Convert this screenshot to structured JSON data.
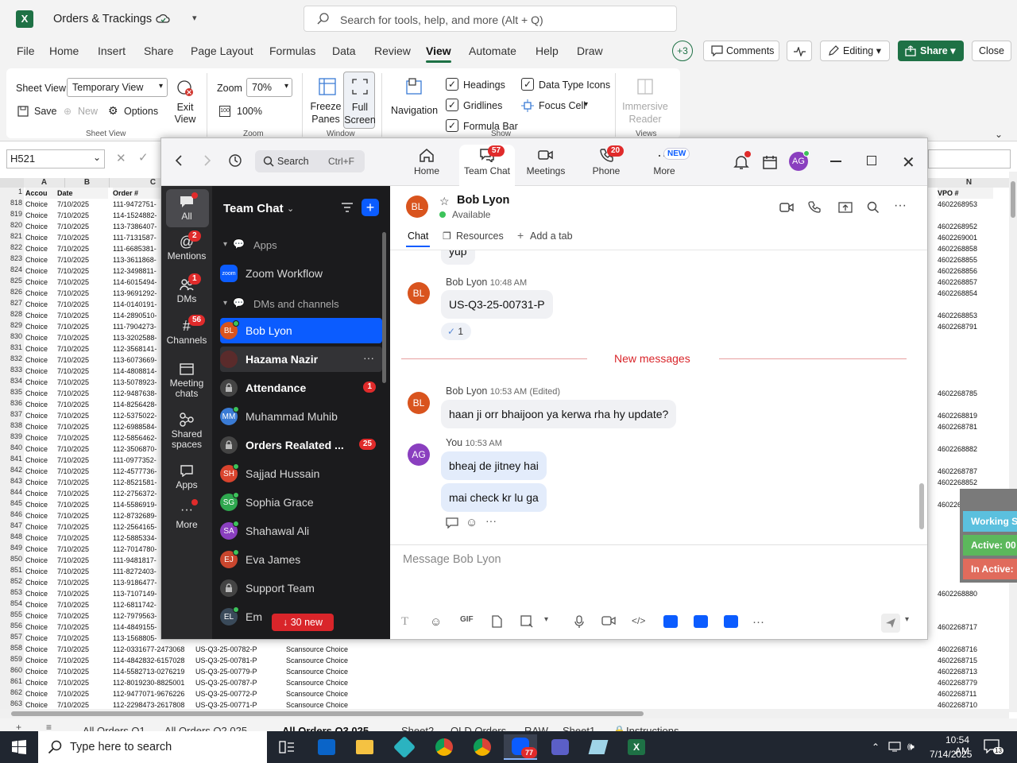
{
  "excel": {
    "title": "Orders & Trackings",
    "search_placeholder": "Search for tools, help, and more (Alt + Q)",
    "menu": [
      "File",
      "Home",
      "Insert",
      "Share",
      "Page Layout",
      "Formulas",
      "Data",
      "Review",
      "View",
      "Automate",
      "Help",
      "Draw"
    ],
    "active_menu": "View",
    "plus_badge": "+3",
    "comments": "Comments",
    "editing": "Editing",
    "share": "Share",
    "close": "Close",
    "ribbon": {
      "sheet_view_label": "Sheet View",
      "sheet_view_value": "Temporary View",
      "save": "Save",
      "new": "New",
      "options": "Options",
      "exit_view": "Exit View",
      "group_sheet_view": "Sheet View",
      "zoom_label": "Zoom",
      "zoom_value": "70%",
      "zoom_100": "100%",
      "group_zoom": "Zoom",
      "freeze_panes": "Freeze Panes",
      "full_screen": "Full Screen",
      "group_window": "Window",
      "navigation": "Navigation",
      "headings": "Headings",
      "gridlines": "Gridlines",
      "formula_bar": "Formula Bar",
      "data_type_icons": "Data Type Icons",
      "focus_cell": "Focus Cell",
      "group_show": "Show",
      "immersive_reader": "Immersive Reader",
      "group_views": "Views"
    },
    "name_box": "H521",
    "columns": [
      "A",
      "B",
      "C",
      "N"
    ],
    "col_headers": {
      "a": "Accou",
      "b": "Date",
      "c": "Order #",
      "n": "VPO #"
    },
    "rows": [
      {
        "n": "818",
        "a": "Choice",
        "b": "7/10/2025",
        "c": "111-9472751-",
        "v": "4602268953"
      },
      {
        "n": "819",
        "a": "Choice",
        "b": "7/10/2025",
        "c": "114-1524882-",
        "v": ""
      },
      {
        "n": "820",
        "a": "Choice",
        "b": "7/10/2025",
        "c": "113-7386407-",
        "v": "4602268952"
      },
      {
        "n": "821",
        "a": "Choice",
        "b": "7/10/2025",
        "c": "111-7131587-",
        "v": "4602269001"
      },
      {
        "n": "822",
        "a": "Choice",
        "b": "7/10/2025",
        "c": "111-6685381-",
        "v": "4602268858"
      },
      {
        "n": "823",
        "a": "Choice",
        "b": "7/10/2025",
        "c": "113-3611868-",
        "v": "4602268855"
      },
      {
        "n": "824",
        "a": "Choice",
        "b": "7/10/2025",
        "c": "112-3498811-",
        "v": "4602268856"
      },
      {
        "n": "825",
        "a": "Choice",
        "b": "7/10/2025",
        "c": "114-6015494-",
        "v": "4602268857"
      },
      {
        "n": "826",
        "a": "Choice",
        "b": "7/10/2025",
        "c": "113-9691292-",
        "v": "4602268854"
      },
      {
        "n": "827",
        "a": "Choice",
        "b": "7/10/2025",
        "c": "114-0140191-",
        "v": ""
      },
      {
        "n": "828",
        "a": "Choice",
        "b": "7/10/2025",
        "c": "114-2890510-",
        "v": "4602268853"
      },
      {
        "n": "829",
        "a": "Choice",
        "b": "7/10/2025",
        "c": "111-7904273-",
        "v": "4602268791"
      },
      {
        "n": "830",
        "a": "Choice",
        "b": "7/10/2025",
        "c": "113-3202588-",
        "v": ""
      },
      {
        "n": "831",
        "a": "Choice",
        "b": "7/10/2025",
        "c": "112-3568141-",
        "v": ""
      },
      {
        "n": "832",
        "a": "Choice",
        "b": "7/10/2025",
        "c": "113-6073669-",
        "v": ""
      },
      {
        "n": "833",
        "a": "Choice",
        "b": "7/10/2025",
        "c": "114-4808814-",
        "v": ""
      },
      {
        "n": "834",
        "a": "Choice",
        "b": "7/10/2025",
        "c": "113-5078923-",
        "v": ""
      },
      {
        "n": "835",
        "a": "Choice",
        "b": "7/10/2025",
        "c": "112-9487638-",
        "v": "4602268785"
      },
      {
        "n": "836",
        "a": "Choice",
        "b": "7/10/2025",
        "c": "114-8256428-",
        "v": ""
      },
      {
        "n": "837",
        "a": "Choice",
        "b": "7/10/2025",
        "c": "112-5375022-",
        "v": "4602268819"
      },
      {
        "n": "838",
        "a": "Choice",
        "b": "7/10/2025",
        "c": "112-6988584-",
        "v": "4602268781"
      },
      {
        "n": "839",
        "a": "Choice",
        "b": "7/10/2025",
        "c": "112-5856462-",
        "v": ""
      },
      {
        "n": "840",
        "a": "Choice",
        "b": "7/10/2025",
        "c": "112-3506870-",
        "v": "4602268882"
      },
      {
        "n": "841",
        "a": "Choice",
        "b": "7/10/2025",
        "c": "111-0977352-",
        "v": ""
      },
      {
        "n": "842",
        "a": "Choice",
        "b": "7/10/2025",
        "c": "112-4577736-",
        "v": "4602268787"
      },
      {
        "n": "843",
        "a": "Choice",
        "b": "7/10/2025",
        "c": "112-8521581-",
        "v": "4602268852"
      },
      {
        "n": "844",
        "a": "Choice",
        "b": "7/10/2025",
        "c": "112-2756372-",
        "v": ""
      },
      {
        "n": "845",
        "a": "Choice",
        "b": "7/10/2025",
        "c": "114-5586919-",
        "v": "4602268786"
      },
      {
        "n": "846",
        "a": "Choice",
        "b": "7/10/2025",
        "c": "112-8732689-",
        "v": ""
      },
      {
        "n": "847",
        "a": "Choice",
        "b": "7/10/2025",
        "c": "112-2564165-",
        "v": ""
      },
      {
        "n": "848",
        "a": "Choice",
        "b": "7/10/2025",
        "c": "112-5885334-",
        "v": ""
      },
      {
        "n": "849",
        "a": "Choice",
        "b": "7/10/2025",
        "c": "112-7014780-",
        "v": ""
      },
      {
        "n": "850",
        "a": "Choice",
        "b": "7/10/2025",
        "c": "111-9481817-",
        "v": ""
      },
      {
        "n": "851",
        "a": "Choice",
        "b": "7/10/2025",
        "c": "111-8272403-",
        "v": ""
      },
      {
        "n": "852",
        "a": "Choice",
        "b": "7/10/2025",
        "c": "113-9186477-",
        "v": ""
      },
      {
        "n": "853",
        "a": "Choice",
        "b": "7/10/2025",
        "c": "113-7107149-",
        "v": "4602268880"
      },
      {
        "n": "854",
        "a": "Choice",
        "b": "7/10/2025",
        "c": "112-6811742-",
        "v": ""
      },
      {
        "n": "855",
        "a": "Choice",
        "b": "7/10/2025",
        "c": "112-7979563-",
        "v": ""
      },
      {
        "n": "856",
        "a": "Choice",
        "b": "7/10/2025",
        "c": "114-4849155-",
        "v": "4602268717"
      },
      {
        "n": "857",
        "a": "Choice",
        "b": "7/10/2025",
        "c": "113-1568805-",
        "v": ""
      }
    ],
    "bottom_rows": [
      {
        "n": "858",
        "a": "Choice",
        "b": "7/10/2025",
        "c": "112-0331677-2473068",
        "d": "US-Q3-25-00782-P",
        "e": "Scansource Choice",
        "v": "4602268716"
      },
      {
        "n": "859",
        "a": "Choice",
        "b": "7/10/2025",
        "c": "114-4842832-6157028",
        "d": "US-Q3-25-00781-P",
        "e": "Scansource Choice",
        "v": "4602268715"
      },
      {
        "n": "860",
        "a": "Choice",
        "b": "7/10/2025",
        "c": "114-5582713-0276219",
        "d": "US-Q3-25-00779-P",
        "e": "Scansource Choice",
        "v": "4602268713"
      },
      {
        "n": "861",
        "a": "Choice",
        "b": "7/10/2025",
        "c": "112-8019230-8825001",
        "d": "US-Q3-25-00787-P",
        "e": "Scansource Choice",
        "v": "4602268779"
      },
      {
        "n": "862",
        "a": "Choice",
        "b": "7/10/2025",
        "c": "112-9477071-9676226",
        "d": "US-Q3-25-00772-P",
        "e": "Scansource Choice",
        "v": "4602268711"
      },
      {
        "n": "863",
        "a": "Choice",
        "b": "7/10/2025",
        "c": "112-2298473-2617808",
        "d": "US-Q3-25-00771-P",
        "e": "Scansource Choice",
        "v": "4602268710"
      }
    ],
    "status_overlay": {
      "working": "Working S",
      "active": "Active: 00",
      "inactive": "In Active:"
    }
  },
  "zoom": {
    "search_label": "Search",
    "search_shortcut": "Ctrl+F",
    "tabs": [
      {
        "label": "Home",
        "badge": ""
      },
      {
        "label": "Team Chat",
        "badge": "57"
      },
      {
        "label": "Meetings",
        "badge": ""
      },
      {
        "label": "Phone",
        "badge": "20"
      },
      {
        "label": "More",
        "badge": "NEW"
      }
    ],
    "user_initials": "AG",
    "rail": [
      {
        "label": "All",
        "badge": ""
      },
      {
        "label": "Mentions",
        "badge": "2"
      },
      {
        "label": "DMs",
        "badge": "1"
      },
      {
        "label": "Channels",
        "badge": "56"
      },
      {
        "label": "Meeting chats",
        "badge": ""
      },
      {
        "label": "Shared spaces",
        "badge": ""
      },
      {
        "label": "Apps",
        "badge": ""
      },
      {
        "label": "More",
        "badge": ""
      }
    ],
    "list_title": "Team Chat",
    "section_apps": "Apps",
    "zoom_workflow": "Zoom Workflow",
    "zoom_logo_text": "zoom",
    "section_dms": "DMs and channels",
    "contacts": [
      {
        "initials": "BL",
        "name": "Bob Lyon",
        "color": "#d9541e",
        "bold": false,
        "badge": ""
      },
      {
        "initials": "",
        "name": "Hazama Nazir",
        "color": "#5a2b2b",
        "bold": true,
        "badge": ""
      },
      {
        "initials": "",
        "name": "Attendance",
        "color": "#444",
        "bold": true,
        "badge": "1"
      },
      {
        "initials": "MM",
        "name": "Muhammad Muhib",
        "color": "#3a7bd5",
        "bold": false,
        "badge": ""
      },
      {
        "initials": "",
        "name": "Orders Realated ...",
        "color": "#444",
        "bold": true,
        "badge": "25"
      },
      {
        "initials": "SH",
        "name": "Sajjad Hussain",
        "color": "#d9442e",
        "bold": false,
        "badge": ""
      },
      {
        "initials": "SG",
        "name": "Sophia Grace",
        "color": "#2fa84f",
        "bold": false,
        "badge": ""
      },
      {
        "initials": "SA",
        "name": "Shahawal Ali",
        "color": "#8a3fbf",
        "bold": false,
        "badge": ""
      },
      {
        "initials": "EJ",
        "name": "Eva James",
        "color": "#c9462e",
        "bold": false,
        "badge": ""
      },
      {
        "initials": "",
        "name": "Support Team",
        "color": "#444",
        "bold": false,
        "badge": ""
      },
      {
        "initials": "EL",
        "name": "Em",
        "color": "#3a4a5a",
        "bold": false,
        "badge": ""
      }
    ],
    "new_pill": "↓ 30 new",
    "chat": {
      "name": "Bob Lyon",
      "initials": "BL",
      "status": "Available",
      "tab_chat": "Chat",
      "tab_resources": "Resources",
      "tab_add": "Add a tab",
      "prev_bubble": "yup",
      "m1_sender": "Bob Lyon",
      "m1_time": "10:48 AM",
      "m1_text": "US-Q3-25-00731-P",
      "m1_reaction": "1",
      "new_messages": "New messages",
      "m2_sender": "Bob Lyon",
      "m2_time": "10:53 AM",
      "m2_edited": "(Edited)",
      "m2_text": "haan ji orr bhaijoon ya kerwa rha hy update?",
      "m3_sender": "You",
      "m3_time": "10:53 AM",
      "m3_initials": "AG",
      "m3_text1": "bheaj de jitney hai",
      "m3_text2": "mai check kr lu ga",
      "compose_placeholder": "Message Bob Lyon",
      "gif": "GIF"
    }
  },
  "sheet_tabs": [
    "All Orders Q1",
    "All Orders Q2 025",
    "All Orders Q3 025",
    "Sheet2",
    "OLD Orders",
    "RAW",
    "Sheet1",
    "Instructions"
  ],
  "taskbar": {
    "search": "Type here to search",
    "time": "10:54 AM",
    "date": "7/14/2025",
    "zoom_badge": "77",
    "notif_count": "13"
  },
  "colors": {
    "excel_green": "#1e7145",
    "zoom_blue": "#0b5cff",
    "badge_red": "#e02b2b"
  }
}
